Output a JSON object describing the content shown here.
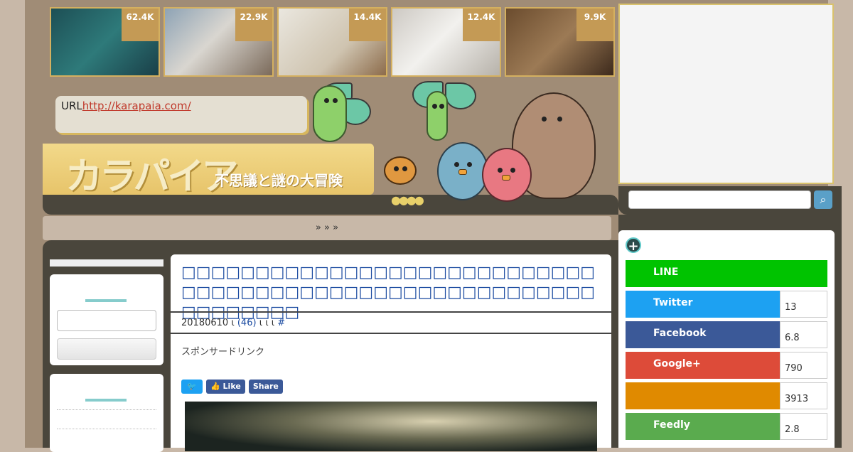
{
  "thumbnails": [
    {
      "count": "62.4K",
      "subject": "ocean-animal"
    },
    {
      "count": "22.9K",
      "subject": "siamese-cat"
    },
    {
      "count": "14.4K",
      "subject": "child-drawing"
    },
    {
      "count": "12.4K",
      "subject": "white-dog-and-kitten"
    },
    {
      "count": "9.9K",
      "subject": "rabbit-on-person"
    }
  ],
  "header": {
    "url_label": "URL",
    "url": "http://karapaia.com/",
    "logo": "カラパイア",
    "tagline": "不思議と謎の大冒険"
  },
  "breadcrumb": "»   »   »",
  "article": {
    "title": "□□□□□□□□□□□□□□□□□□□□□□□□□□□□□□□□□□□□□□□□□□□□□□□□□□□□□□□□□□□□□□□□",
    "date": "20180610",
    "sep1": "ι",
    "comments": "(46)",
    "sep2": "ι ι ι",
    "hash": "#",
    "sponsor": "スポンサードリンク",
    "share": {
      "like": "Like",
      "share": "Share"
    }
  },
  "follow": [
    {
      "name": "LINE",
      "count": "",
      "color": "#00c300"
    },
    {
      "name": "Twitter",
      "count": "13",
      "color": "#1da1f2"
    },
    {
      "name": "Facebook",
      "count": "6.8",
      "color": "#3b5998"
    },
    {
      "name": "Google+",
      "count": "790",
      "color": "#dd4b39"
    },
    {
      "name": "",
      "count": "3913",
      "color": "#e08a00"
    },
    {
      "name": "Feedly",
      "count": "2.8",
      "color": "#5aab4e"
    }
  ],
  "icons": {
    "search": "magnifier",
    "plus": "plus-circle"
  }
}
